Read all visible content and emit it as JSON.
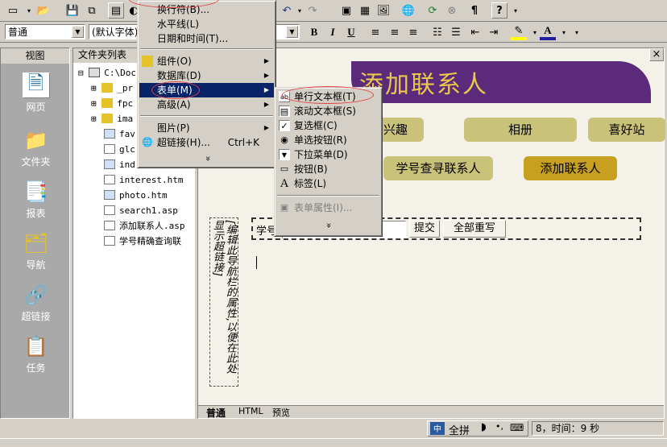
{
  "toolbar": {
    "style_value": "普通",
    "font_value": "(默认字体)",
    "bold": "B",
    "italic": "I",
    "underline": "U",
    "paragraph": "¶",
    "help": "?"
  },
  "views": {
    "title": "视图",
    "items": [
      "网页",
      "文件夹",
      "报表",
      "导航",
      "超链接",
      "任务"
    ]
  },
  "folders": {
    "title": "文件夹列表",
    "close": "×",
    "root": "C:\\Doc",
    "items": [
      "_pr",
      "fpc",
      "ima",
      "fav",
      "glc",
      "ind",
      "interest.htm",
      "photo.htm",
      "search1.asp",
      "添加联系人.asp",
      "学号精确查询联"
    ]
  },
  "editor": {
    "banner": "添加联系人",
    "nav_row1": [
      "兴趣",
      "相册",
      "喜好站"
    ],
    "nav_row2": [
      "学号查寻联系人",
      "添加联系人"
    ],
    "left_note": "[编辑此导航栏的属性,以便在此处显示超链接]",
    "form_label": "学号",
    "submit": "提交",
    "reset": "全部重写",
    "tabs": [
      "普通",
      "HTML",
      "预览"
    ]
  },
  "insert_menu": {
    "items": [
      {
        "label": "换行符(B)..."
      },
      {
        "label": "水平线(L)"
      },
      {
        "label": "日期和时间(T)..."
      },
      {
        "label": "组件(O)",
        "sub": true
      },
      {
        "label": "数据库(D)",
        "sub": true
      },
      {
        "label": "表单(M)",
        "sub": true,
        "highlight": true
      },
      {
        "label": "高级(A)",
        "sub": true
      },
      {
        "label": "图片(P)",
        "sub": true
      },
      {
        "label": "超链接(H)...",
        "shortcut": "Ctrl+K"
      }
    ],
    "more": "»"
  },
  "form_menu": {
    "items": [
      "单行文本框(T)",
      "滚动文本框(S)",
      "复选框(C)",
      "单选按钮(R)",
      "下拉菜单(D)",
      "按钮(B)",
      "标签(L)",
      "表单属性(I)..."
    ],
    "more": "»"
  },
  "status": {
    "ime": "全拼",
    "time": "8，时间：9 秒"
  },
  "accent_color": "#0a246a",
  "banner_color": "#5b2a7a"
}
